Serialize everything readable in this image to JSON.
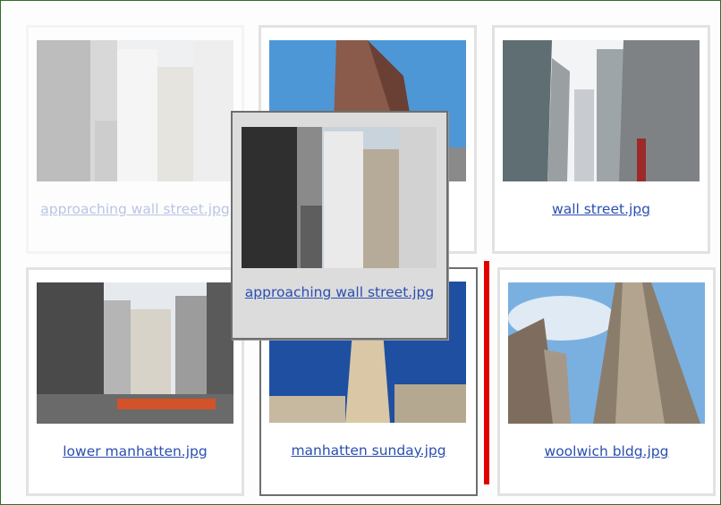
{
  "gallery": {
    "items": [
      {
        "caption": "approaching wall street.jpg",
        "icon": "image-thumbnail",
        "state": "dragging-source"
      },
      {
        "caption": "",
        "icon": "image-thumbnail",
        "state": "covered"
      },
      {
        "caption": "wall street.jpg",
        "icon": "image-thumbnail",
        "state": "normal"
      },
      {
        "caption": "lower manhatten.jpg",
        "icon": "image-thumbnail",
        "state": "normal"
      },
      {
        "caption": "manhatten sunday.jpg",
        "icon": "image-thumbnail",
        "state": "drop-target"
      },
      {
        "caption": "woolwich bldg.jpg",
        "icon": "image-thumbnail",
        "state": "normal"
      }
    ],
    "drag_preview": {
      "caption": "approaching wall street.jpg"
    },
    "colors": {
      "link": "#2b4fb0",
      "drop_indicator": "#e00000",
      "card_border": "#e2e2e2",
      "frame_border": "#2f6e2a"
    }
  }
}
